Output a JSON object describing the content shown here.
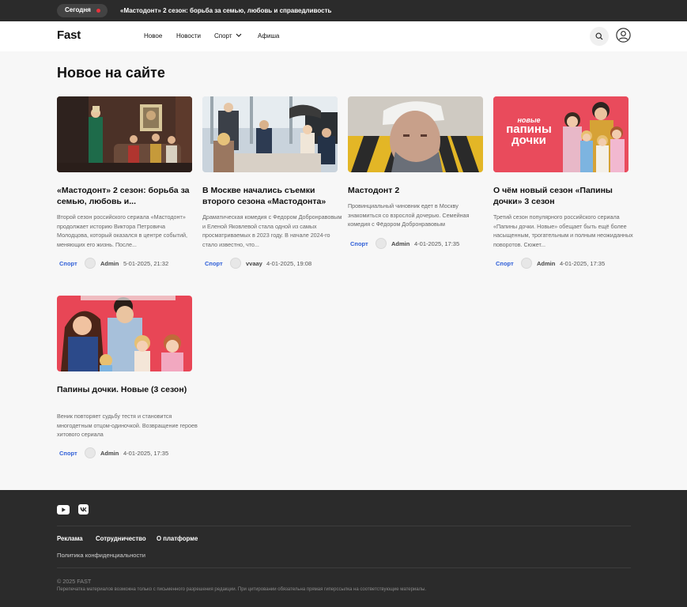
{
  "topbar": {
    "today_label": "Сегодня",
    "headline": "«Мастодонт» 2 сезон: борьба за семью, любовь и справедливость"
  },
  "header": {
    "logo": "Fast",
    "nav": [
      {
        "label": "Новое"
      },
      {
        "label": "Новости"
      },
      {
        "label": "Спорт"
      },
      {
        "label": "Афиша"
      }
    ],
    "icons": {
      "search": "search-icon",
      "profile": "user-profile-icon",
      "dropdown": "chevron-down-icon"
    }
  },
  "main": {
    "section_title": "Новое на сайте",
    "articles": [
      {
        "title": "«Мастодонт» 2 сезон: борьба за семью, любовь и...",
        "description": "Второй сезон российского сериала «Мастодонт» продолжает историю Виктора Петровича Молодцова, который оказался в центре событий, меняющих его жизнь. После...",
        "category": "Спорт",
        "author": "Admin",
        "date": "5-01-2025, 21:32"
      },
      {
        "title": "В Москве начались съемки второго сезона «Мастодонта»",
        "description": "Драматическая комедия с Федором Добронравовым и Еленой Яковлевой стала одной из самых просматриваемых в 2023 году. В начале 2024-го стало известно, что...",
        "category": "Спорт",
        "author": "vvaay",
        "date": "4-01-2025, 19:08"
      },
      {
        "title": "Мастодонт 2",
        "description": "Провинциальный чиновник едет в Москву знакомиться со взрослой дочерью. Семейная комедия с Фёдором Добронравовым",
        "category": "Спорт",
        "author": "Admin",
        "date": "4-01-2025, 17:35"
      },
      {
        "title": "О чём новый сезон «Папины дочки» 3 сезон",
        "description": "Третий сезон популярного российского сериала «Папины дочки. Новые» обещает быть ещё более насыщенным, трогательным и полным неожиданных поворотов. Сюжет...",
        "category": "Спорт",
        "author": "Admin",
        "date": "4-01-2025, 17:35",
        "image_text": {
          "line1": "новые",
          "line2": "папины",
          "line3": "дочки"
        }
      },
      {
        "title": "Папины дочки. Новые (3 сезон)",
        "description": "Веник повторяет судьбу тестя и становится многодетным отцом-одиночкой. Возвращение героев хитового сериала",
        "category": "Спорт",
        "author": "Admin",
        "date": "4-01-2025, 17:35"
      }
    ]
  },
  "footer": {
    "social": [
      {
        "icon": "youtube-icon"
      },
      {
        "icon": "vk-icon"
      }
    ],
    "links": [
      {
        "label": "Реклама"
      },
      {
        "label": "Сотрудничество"
      },
      {
        "label": "О платформе"
      }
    ],
    "privacy": "Политика конфиденциальности",
    "copyright": "© 2025 FAST",
    "disclaimer": "Перепечатка материалов возможна только с письменного разрешения редакции. При цитировании обязательна прямая гиперссылка на соответствующие материалы."
  },
  "colors": {
    "topbar_bg": "#2b2b2b",
    "accent_blue": "#2f5fd8",
    "live_dot": "#e8323c",
    "footer_bg": "#2b2b2b"
  }
}
